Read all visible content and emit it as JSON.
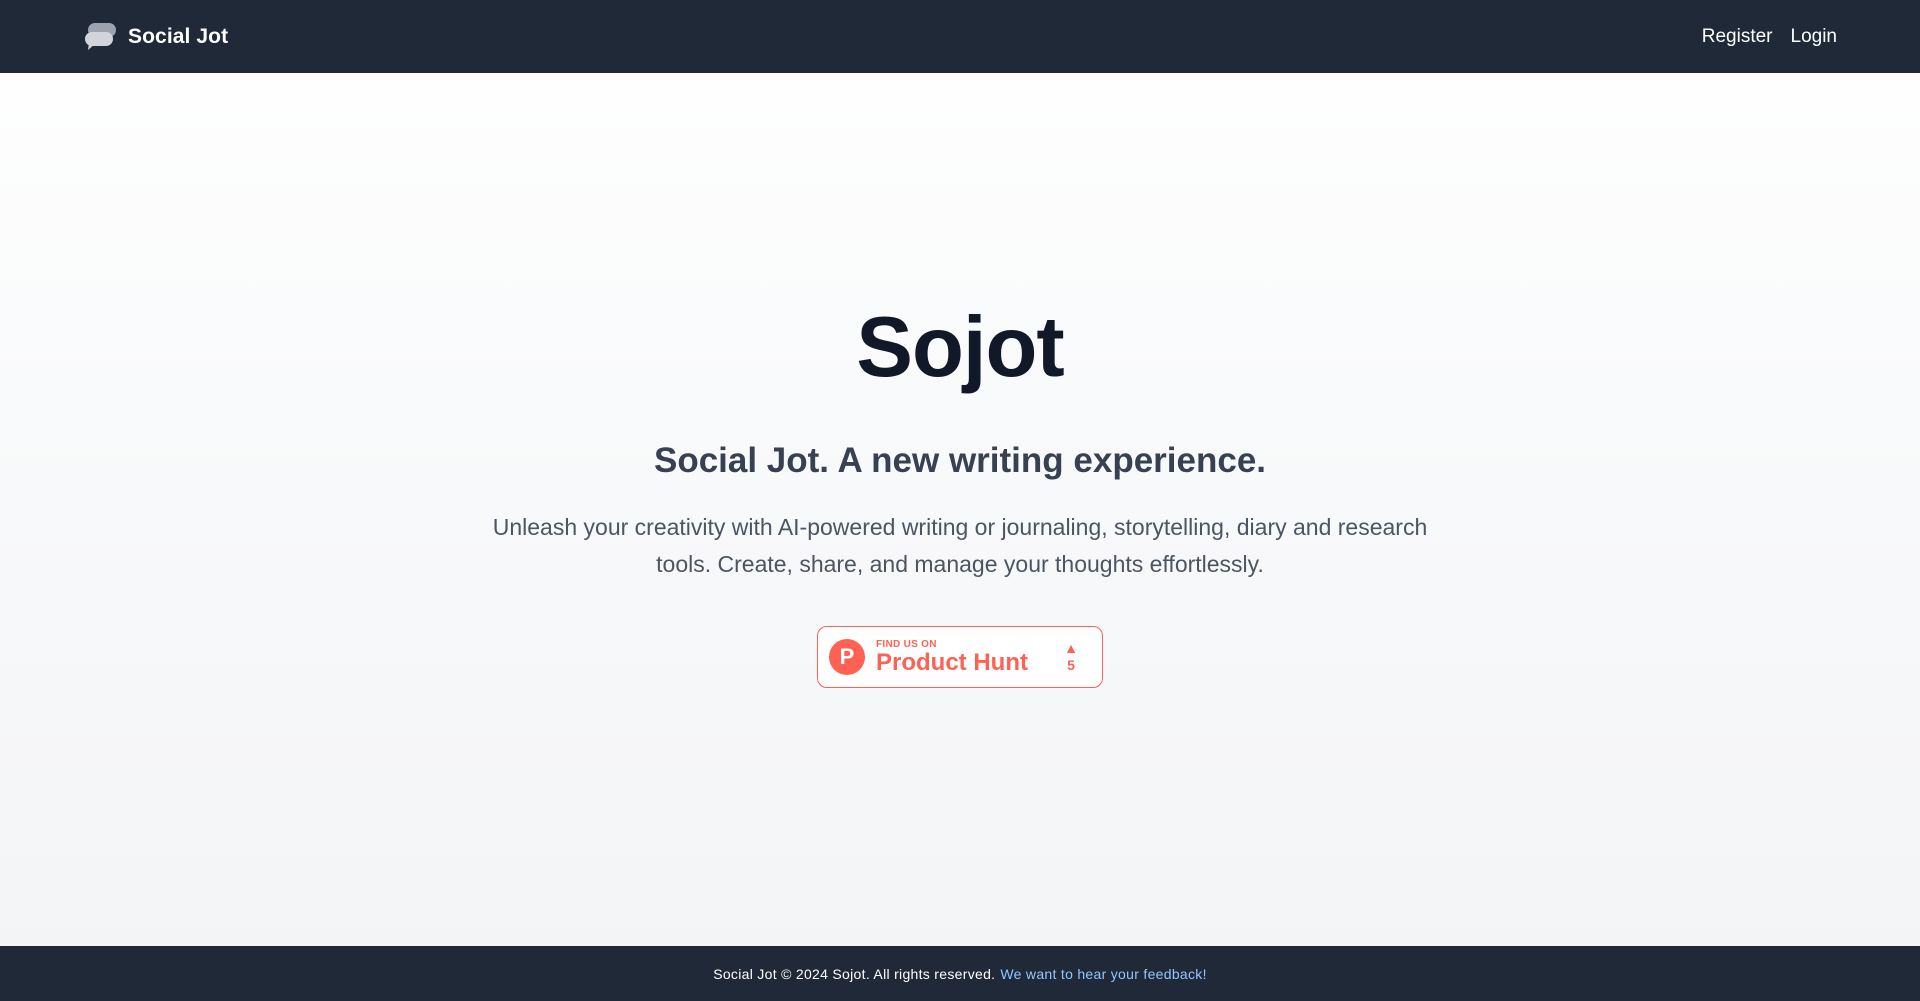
{
  "nav": {
    "brand": "Social Jot",
    "brand_icon": "chat-bubbles-icon",
    "links": [
      {
        "label": "Register"
      },
      {
        "label": "Login"
      }
    ]
  },
  "hero": {
    "title": "Sojot",
    "subtitle": "Social Jot. A new writing experience.",
    "description": "Unleash your creativity with AI-powered writing or journaling, storytelling, diary and research tools. Create, share, and manage your thoughts effortlessly."
  },
  "product_hunt": {
    "logo_letter": "P",
    "small_text": "FIND US ON",
    "big_text": "Product Hunt",
    "votes": "5",
    "color": "#ff6154"
  },
  "footer": {
    "text": "Social Jot © 2024 Sojot. All rights reserved.",
    "link": "We want to hear your feedback!"
  },
  "colors": {
    "nav_bg": "#1f2937",
    "accent_link": "#93c5fd"
  }
}
